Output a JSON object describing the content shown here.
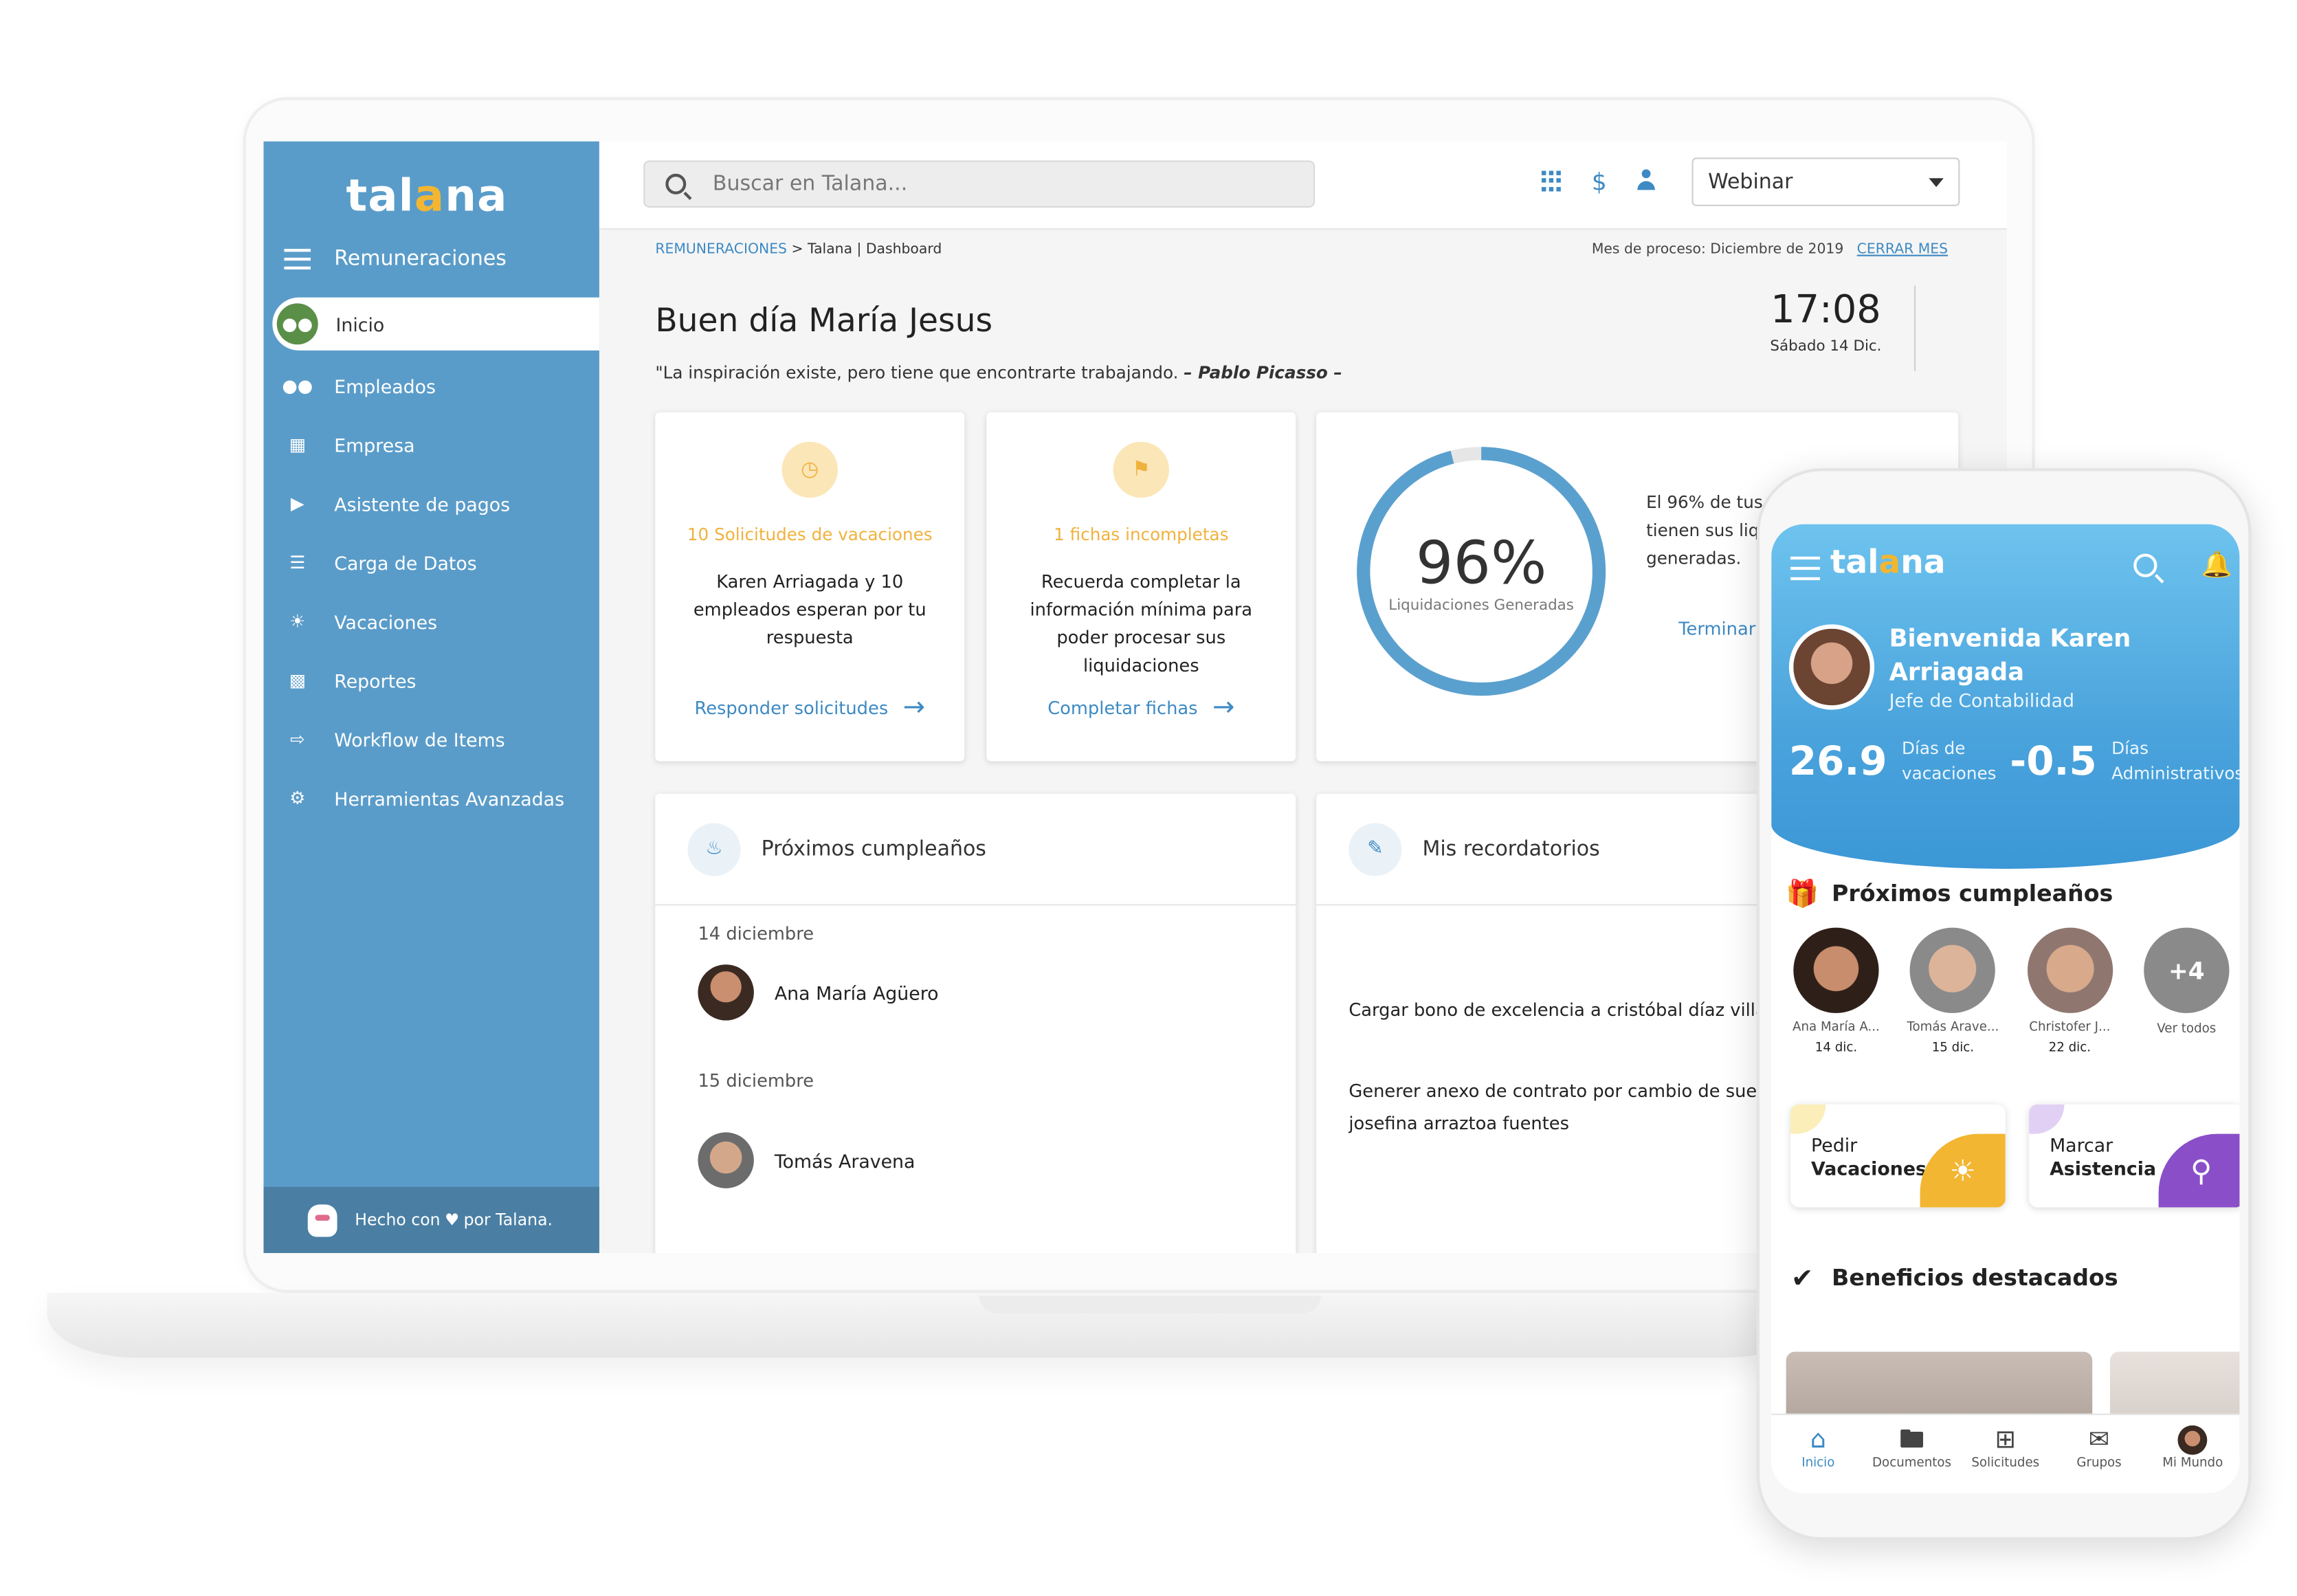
{
  "desktop": {
    "logo": {
      "pre": "tal",
      "accent": "a",
      "post": "na"
    },
    "module": "Remuneraciones",
    "nav": [
      {
        "label": "Inicio",
        "icon": "people-icon"
      },
      {
        "label": "Empleados",
        "icon": "people-icon"
      },
      {
        "label": "Empresa",
        "icon": "building-icon"
      },
      {
        "label": "Asistente de pagos",
        "icon": "play-icon"
      },
      {
        "label": "Carga de Datos",
        "icon": "list-icon"
      },
      {
        "label": "Vacaciones",
        "icon": "sun-icon"
      },
      {
        "label": "Reportes",
        "icon": "report-icon"
      },
      {
        "label": "Workflow de Items",
        "icon": "workflow-icon"
      },
      {
        "label": "Herramientas Avanzadas",
        "icon": "gear-icon"
      }
    ],
    "footer": {
      "pre": "Hecho con",
      "post": "por Talana."
    },
    "search_placeholder": "Buscar en Talana...",
    "dollar": "$",
    "company_select": "Webinar",
    "breadcrumb": {
      "section": "REMUNERACIONES",
      "page": "> Talana | Dashboard"
    },
    "process": {
      "label": "Mes de proceso: Diciembre de 2019",
      "action": "CERRAR MES"
    },
    "greeting": "Buen día María Jesus",
    "quote": {
      "text": "\"La inspiración existe, pero tiene que encontrarte trabajando.",
      "author": "– Pablo Picasso –"
    },
    "clock": {
      "time": "17:08",
      "date": "Sábado 14 Dic."
    },
    "alerts": [
      {
        "title": "10 Solicitudes de vacaciones",
        "text": "Karen Arriagada y 10 empleados esperan por tu respuesta",
        "link": "Responder solicitudes"
      },
      {
        "title": "1 fichas incompletas",
        "text": "Recuerda completar la información mínima para poder procesar sus liquidaciones",
        "link": "Completar fichas"
      }
    ],
    "gauge": {
      "percent": 96,
      "value_label": "96%",
      "label": "Liquidaciones Generadas",
      "text_lines": [
        "El 96% de tus",
        "tienen sus liq",
        "generadas."
      ],
      "link": "Terminar",
      "color": "#5aa0cf"
    },
    "birthdays": {
      "title": "Próximos cumpleaños",
      "groups": [
        {
          "date": "14 diciembre",
          "name": "Ana María Agüero"
        },
        {
          "date": "15 diciembre",
          "name": "Tomás Aravena"
        }
      ]
    },
    "reminders": {
      "title": "Mis recordatorios",
      "items": [
        "Cargar bono de excelencia a cristóbal díaz villalo",
        "Generer anexo de contrato por cambio de sueld",
        "josefina arraztoa fuentes"
      ]
    }
  },
  "mobile": {
    "logo": {
      "pre": "tal",
      "accent": "a",
      "post": "na"
    },
    "welcome": "Bienvenida Karen Arriagada",
    "role": "Jefe de Contabilidad",
    "stats": [
      {
        "value": "26.9",
        "label_1": "Días de",
        "label_2": "vacaciones"
      },
      {
        "value": "-0.5",
        "label_1": "Días",
        "label_2": "Administrativos"
      }
    ],
    "birthdays_title": "Próximos cumpleaños",
    "birthdays": [
      {
        "name": "Ana María A...",
        "date": "14 dic."
      },
      {
        "name": "Tomás Arave...",
        "date": "15 dic."
      },
      {
        "name": "Christofer J...",
        "date": "22 dic."
      }
    ],
    "more": {
      "count": "+4",
      "label": "Ver todos"
    },
    "actions": [
      {
        "line1": "Pedir",
        "line2": "Vacaciones",
        "color": "#f2b632",
        "icon": "sun-icon"
      },
      {
        "line1": "Marcar",
        "line2": "Asistencia",
        "color": "#8a4fc8",
        "icon": "location-pin-icon"
      }
    ],
    "benefits_title": "Beneficios destacados",
    "tabs": [
      "Inicio",
      "Documentos",
      "Solicitudes",
      "Grupos",
      "Mi Mundo"
    ]
  }
}
